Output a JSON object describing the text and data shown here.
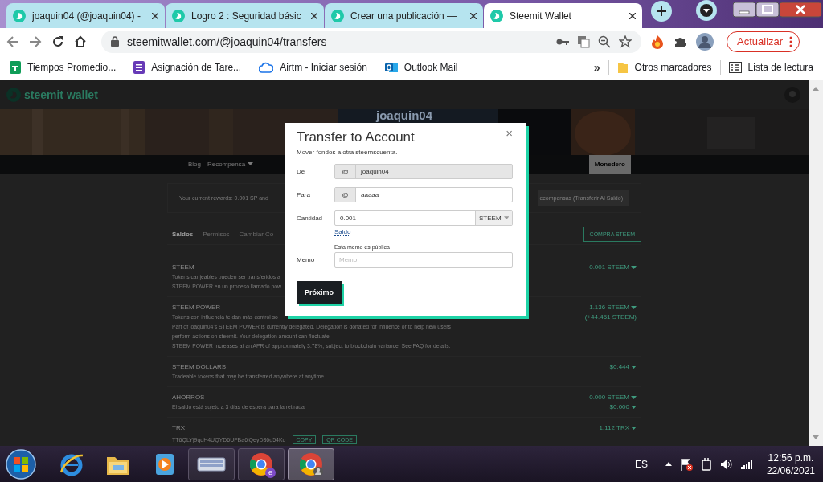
{
  "browser": {
    "tabs": [
      {
        "title": "joaquin04 (@joaquin04) -",
        "selected": false
      },
      {
        "title": "Logro 2 : Seguridad básic",
        "selected": false
      },
      {
        "title": "Crear una publicación —",
        "selected": false
      },
      {
        "title": "Steemit Wallet",
        "selected": true
      }
    ],
    "url": "steemitwallet.com/@joaquin04/transfers",
    "update_button": "Actualizar",
    "bookmarks": [
      {
        "label": "Tiempos Promedio...",
        "kind": "sheets"
      },
      {
        "label": "Asignación de Tare...",
        "kind": "forms"
      },
      {
        "label": "Airtm - Iniciar sesión",
        "kind": "cloud"
      },
      {
        "label": "Outlook Mail",
        "kind": "outlook"
      }
    ],
    "bookmarks_more": "»",
    "other_bookmarks": "Otros marcadores",
    "reading_list": "Lista de lectura"
  },
  "page": {
    "logo": "steemit wallet",
    "username": "joaquin04",
    "nav": [
      {
        "label": "Blog",
        "selected": false,
        "dropdown": false
      },
      {
        "label": "Recompensa",
        "selected": false,
        "dropdown": true
      },
      {
        "label": "Monedero",
        "selected": true,
        "dropdown": false
      }
    ],
    "rewards": {
      "text": "Your current rewards: 0.001 SP and",
      "button": "ecompensas (Transferir Al Saldo)"
    },
    "wallet_tabs": [
      {
        "label": "Saldos",
        "selected": true
      },
      {
        "label": "Permisos",
        "selected": false
      },
      {
        "label": "Cambiar Co",
        "selected": false
      }
    ],
    "buy_button": "COMPRA STEEM",
    "balances": [
      {
        "name": "STEEM",
        "description": [
          "Tokens canjeables pueden ser transferidos a",
          "STEEM POWER en un proceso llamado pow"
        ],
        "values": [
          {
            "text": "0.001 STEEM",
            "dropdown": true
          }
        ]
      },
      {
        "name": "STEEM POWER",
        "description": [
          "Tokens con influencia te dan más control so",
          "Part of joaquin04's STEEM POWER is currently delegated. Delegation is donated for influence or to help new users",
          "perform actions on steemit. Your delegation amount can fluctuate.",
          "STEEM POWER increases at an APR of approximately 3.78%, subject to blockchain variance. See FAQ for details."
        ],
        "values": [
          {
            "text": "1.136 STEEM",
            "dropdown": true
          },
          {
            "text": "(+44.451 STEEM)",
            "dropdown": false
          }
        ]
      },
      {
        "name": "STEEM DOLLARS",
        "description": [
          "Tradeable tokens that may be transferred anywhere at anytime."
        ],
        "values": [
          {
            "text": "$0.444",
            "dropdown": true
          }
        ]
      },
      {
        "name": "AHORROS",
        "description": [
          "El saldo está sujeto a 3 días de espera para la retirada"
        ],
        "values": [
          {
            "text": "0.000 STEEM",
            "dropdown": true
          },
          {
            "text": "$0.000",
            "dropdown": true
          }
        ]
      }
    ],
    "trx": {
      "name": "TRX",
      "value": "1.112 TRX",
      "address": "TT6QLYj9qqH4UQYD6UFBa6lQeyD86g54Ko",
      "copy": "COPY",
      "qr": "QR CODE"
    }
  },
  "modal": {
    "title": "Transfer to Account",
    "subtitle": "Mover fondos a otra steemscuenta.",
    "close": "×",
    "fields": [
      {
        "kind": "account",
        "label": "De",
        "prefix": "@",
        "value": "joaquin04",
        "disabled": true
      },
      {
        "kind": "account",
        "label": "Para",
        "prefix": "@",
        "value": "aaaaa",
        "disabled": false
      },
      {
        "kind": "amount",
        "label": "Cantidad",
        "value": "0.001",
        "unit": "STEEM",
        "link": "Saldo"
      },
      {
        "kind": "memo",
        "label": "Memo",
        "placeholder": "Memo",
        "hint": "Esta memo es pública"
      }
    ],
    "submit": "Próximo"
  },
  "taskbar": {
    "apps": [
      {
        "kind": "ie",
        "running": false,
        "active": false
      },
      {
        "kind": "explorer",
        "running": false,
        "active": false
      },
      {
        "kind": "media",
        "running": false,
        "active": false
      },
      {
        "kind": "keyboard",
        "running": true,
        "active": false
      },
      {
        "kind": "chrome",
        "badge": "e",
        "running": true,
        "active": false
      },
      {
        "kind": "chromeuser",
        "running": true,
        "active": true
      }
    ],
    "language": "ES",
    "time": "12:56 p.m.",
    "date": "22/06/2021"
  }
}
